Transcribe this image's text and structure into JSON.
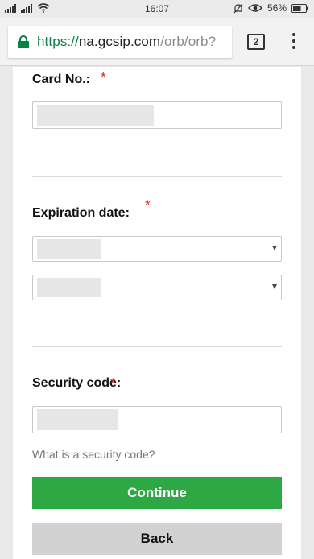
{
  "status_bar": {
    "time": "16:07",
    "battery_percent": "56%"
  },
  "browser": {
    "url_scheme": "https://",
    "url_host": "na.gcsip.com",
    "url_path": "/orb/orb?",
    "tab_count": "2"
  },
  "form": {
    "card_number": {
      "label": "Card No.:",
      "required_mark": "*"
    },
    "expiration": {
      "label": "Expiration date:",
      "required_mark": "*"
    },
    "security_code": {
      "label": "Security code:",
      "required_mark": "*",
      "help_link": "What is a security code?"
    },
    "continue_label": "Continue",
    "back_label": "Back"
  },
  "colors": {
    "accent_green": "#2ea845",
    "secure_green": "#0b8043",
    "required_red": "#d9232d"
  }
}
